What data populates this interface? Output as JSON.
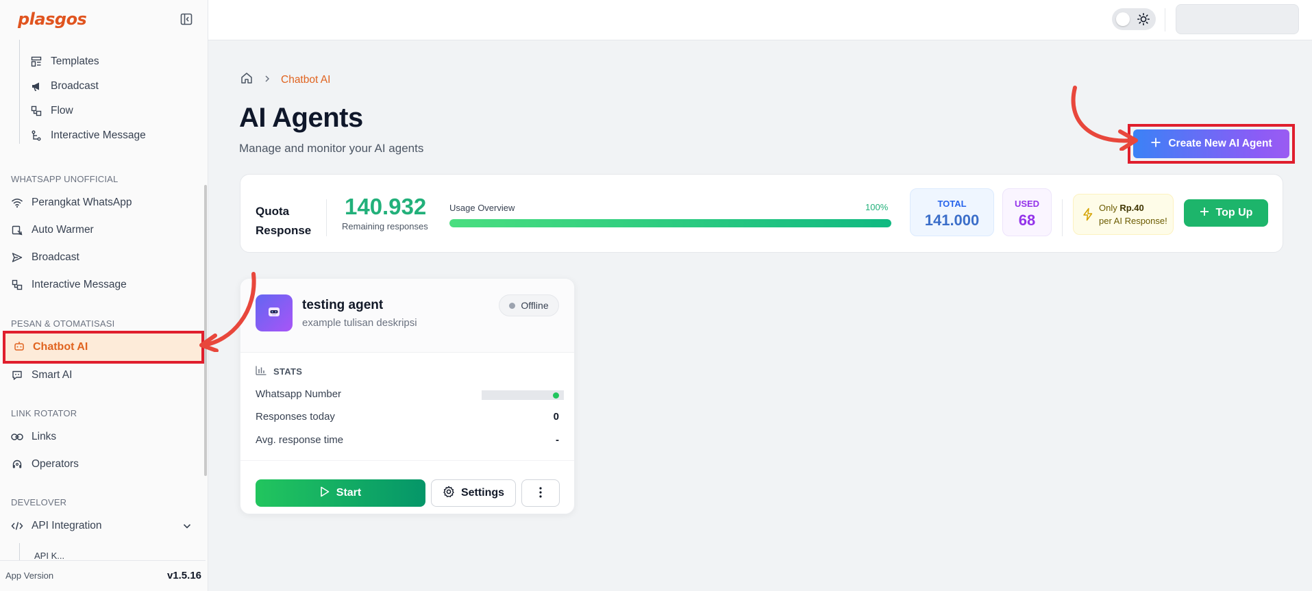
{
  "app": {
    "logo": "plasgos"
  },
  "sidebar": {
    "partial_top_item": "·",
    "sub_items": [
      {
        "label": "Templates",
        "icon": "templates-icon"
      },
      {
        "label": "Broadcast",
        "icon": "megaphone-icon"
      },
      {
        "label": "Flow",
        "icon": "flow-icon"
      },
      {
        "label": "Interactive Message",
        "icon": "branch-icon"
      }
    ],
    "sections": {
      "unofficial": "WHATSAPP UNOFFICIAL",
      "pesan": "PESAN & OTOMATISASI",
      "link": "LINK ROTATOR",
      "developer": "DEVELOVER"
    },
    "unofficial_items": [
      {
        "label": "Perangkat WhatsApp",
        "icon": "wifi-icon"
      },
      {
        "label": "Auto Warmer",
        "icon": "auto-warmer-icon"
      },
      {
        "label": "Broadcast",
        "icon": "send-icon"
      },
      {
        "label": "Interactive Message",
        "icon": "flow-icon"
      }
    ],
    "active_item": {
      "label": "Chatbot AI",
      "icon": "bot-icon"
    },
    "smart_ai": {
      "label": "Smart AI",
      "icon": "chat-bot-icon"
    },
    "link_items": [
      {
        "label": "Links",
        "icon": "link-icon"
      },
      {
        "label": "Operators",
        "icon": "headset-icon"
      }
    ],
    "api": {
      "label": "API Integration",
      "icon": "code-icon"
    },
    "api_sub_partial": "API K...",
    "footer": {
      "label": "App Version",
      "version": "v1.5.16"
    }
  },
  "breadcrumb": {
    "current": "Chatbot AI"
  },
  "page": {
    "title": "AI Agents",
    "subtitle": "Manage and monitor your AI agents"
  },
  "create_button": {
    "label": "Create New AI Agent"
  },
  "quota": {
    "title_line1": "Quota",
    "title_line2": "Response",
    "remaining_value": "140.932",
    "remaining_label": "Remaining responses",
    "usage_label": "Usage Overview",
    "usage_percent": "100%",
    "usage_fraction": 1.0,
    "total_label": "TOTAL",
    "total_value": "141.000",
    "used_label": "USED",
    "used_value": "68",
    "promo_only": "Only ",
    "promo_price": "Rp.40",
    "promo_per": "per AI Response!",
    "topup_label": "Top Up"
  },
  "agent": {
    "name": "testing agent",
    "description": "example tulisan deskripsi",
    "status": "Offline",
    "stats_header": "STATS",
    "rows": [
      {
        "label": "Whatsapp Number",
        "value": ""
      },
      {
        "label": "Responses today",
        "value": "0"
      },
      {
        "label": "Avg. response time",
        "value": "-"
      }
    ],
    "start_label": "Start",
    "settings_label": "Settings"
  },
  "colors": {
    "brand": "#e0541f",
    "highlight_border": "#e01e2d",
    "green": "#22b07a",
    "annotation_arrow": "#e8473c"
  }
}
